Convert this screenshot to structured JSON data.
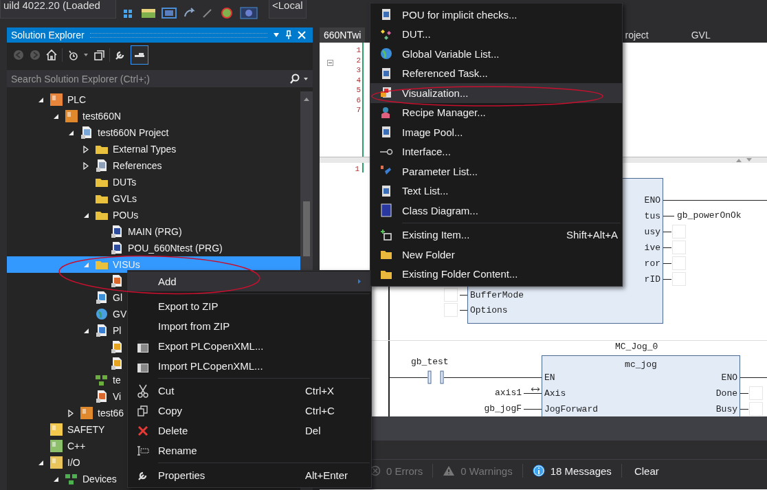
{
  "toolbar": {
    "build_label": "uild 4022.20 (Loaded",
    "target_label": "<Local"
  },
  "solution_explorer": {
    "title": "Solution Explorer",
    "search": {
      "placeholder": "Search Solution Explorer (Ctrl+;)"
    },
    "tree": [
      {
        "label": "PLC",
        "kind": "plc",
        "expanded": true,
        "selected": false,
        "children": [
          {
            "label": "test660N",
            "kind": "plc-project",
            "expanded": true,
            "selected": false,
            "children": [
              {
                "label": "test660N Project",
                "kind": "project",
                "expanded": true,
                "selected": false,
                "children": [
                  {
                    "label": "External Types",
                    "kind": "folder",
                    "expanded": false,
                    "selected": false
                  },
                  {
                    "label": "References",
                    "kind": "references",
                    "expanded": false,
                    "selected": false
                  },
                  {
                    "label": "DUTs",
                    "kind": "folder",
                    "selected": false
                  },
                  {
                    "label": "GVLs",
                    "kind": "folder",
                    "selected": false
                  },
                  {
                    "label": "POUs",
                    "kind": "folder-open",
                    "expanded": true,
                    "selected": false,
                    "children": [
                      {
                        "label": "MAIN (PRG)",
                        "kind": "pou",
                        "selected": false
                      },
                      {
                        "label": "POU_660Ntest (PRG)",
                        "kind": "pou",
                        "selected": false
                      }
                    ]
                  },
                  {
                    "label": "VISUs",
                    "kind": "folder-open",
                    "expanded": true,
                    "selected": true,
                    "children": [
                      {
                        "kind": "visu",
                        "selected": false
                      }
                    ]
                  },
                  {
                    "label": "Gl",
                    "kind": "gvl-task",
                    "selected": false
                  },
                  {
                    "label": "GV",
                    "kind": "gvl",
                    "selected": false
                  },
                  {
                    "label": "Pl",
                    "kind": "task",
                    "expanded": true,
                    "selected": false,
                    "children": [
                      {
                        "kind": "task-item",
                        "selected": false
                      },
                      {
                        "kind": "task-item",
                        "selected": false
                      }
                    ]
                  },
                  {
                    "label": "te",
                    "kind": "instance",
                    "selected": false
                  },
                  {
                    "label": "Vi",
                    "kind": "visu",
                    "selected": false
                  }
                ]
              },
              {
                "label": "test66",
                "kind": "plc-project",
                "expanded": false,
                "selected": false
              }
            ]
          }
        ]
      },
      {
        "label": "SAFETY",
        "kind": "safety",
        "selected": false
      },
      {
        "label": "C++",
        "kind": "cpp",
        "selected": false
      },
      {
        "label": "I/O",
        "kind": "io",
        "expanded": true,
        "selected": false,
        "children": [
          {
            "label": "Devices",
            "kind": "devices",
            "expanded": true,
            "selected": false
          }
        ]
      }
    ]
  },
  "editor": {
    "tabs": [
      {
        "label": "660NTwi",
        "selected": true
      },
      {
        "label": "roject",
        "selected": false
      },
      {
        "label": "GVL",
        "selected": false
      }
    ],
    "line_numbers": [
      "1",
      "2",
      "3",
      "4",
      "5",
      "6",
      "7"
    ],
    "ladder": {
      "network_number": "1",
      "block_1": {
        "inputs": [
          "BufferMode",
          "Options"
        ],
        "outputs": [
          "ENO",
          "tus",
          "usy",
          "ive",
          "ror",
          "rID"
        ],
        "output_variable": "gb_powerOnOk"
      },
      "contact": {
        "variable": "gb_test"
      },
      "block_2": {
        "instance": "MC_Jog_0",
        "type": "mc_jog",
        "inputs": [
          "EN",
          "Axis",
          "JogForward"
        ],
        "outputs": [
          "ENO",
          "Done",
          "Busy"
        ],
        "input_variables": [
          "axis1",
          "gb_jogF"
        ]
      }
    }
  },
  "error_list": {
    "errors": "0 Errors",
    "warnings": "0 Warnings",
    "messages": "18 Messages",
    "clear": "Clear"
  },
  "context_menu": {
    "items": [
      {
        "kind": "item",
        "label": "Add",
        "submenu": true,
        "selected": true
      },
      {
        "kind": "separator"
      },
      {
        "kind": "item",
        "label": "Export to ZIP",
        "selected": false
      },
      {
        "kind": "item",
        "label": "Import from ZIP",
        "selected": false
      },
      {
        "kind": "item",
        "label": "Export PLCopenXML...",
        "selected": false
      },
      {
        "kind": "item",
        "label": "Import PLCopenXML...",
        "selected": false
      },
      {
        "kind": "separator"
      },
      {
        "kind": "item",
        "label": "Cut",
        "shortcut": "Ctrl+X",
        "selected": false
      },
      {
        "kind": "item",
        "label": "Copy",
        "shortcut": "Ctrl+C",
        "selected": false
      },
      {
        "kind": "item",
        "label": "Delete",
        "shortcut": "Del",
        "selected": false
      },
      {
        "kind": "item",
        "label": "Rename",
        "selected": false
      },
      {
        "kind": "separator"
      },
      {
        "kind": "item",
        "label": "Properties",
        "shortcut": "Alt+Enter",
        "selected": false
      }
    ]
  },
  "submenu": {
    "items": [
      {
        "kind": "item",
        "label": "POU for implicit checks...",
        "selected": false
      },
      {
        "kind": "item",
        "label": "DUT...",
        "selected": false
      },
      {
        "kind": "item",
        "label": "Global Variable List...",
        "selected": false
      },
      {
        "kind": "item",
        "label": "Referenced Task...",
        "selected": false
      },
      {
        "kind": "item",
        "label": "Visualization...",
        "selected": true
      },
      {
        "kind": "item",
        "label": "Recipe Manager...",
        "selected": false
      },
      {
        "kind": "item",
        "label": "Image Pool...",
        "selected": false
      },
      {
        "kind": "item",
        "label": "Interface...",
        "selected": false
      },
      {
        "kind": "item",
        "label": "Parameter List...",
        "selected": false
      },
      {
        "kind": "item",
        "label": "Text List...",
        "selected": false
      },
      {
        "kind": "item",
        "label": "Class Diagram...",
        "selected": false
      },
      {
        "kind": "separator"
      },
      {
        "kind": "item",
        "label": "Existing Item...",
        "shortcut": "Shift+Alt+A",
        "selected": false
      },
      {
        "kind": "item",
        "label": "New Folder",
        "selected": false
      },
      {
        "kind": "item",
        "label": "Existing Folder Content...",
        "selected": false
      }
    ]
  }
}
